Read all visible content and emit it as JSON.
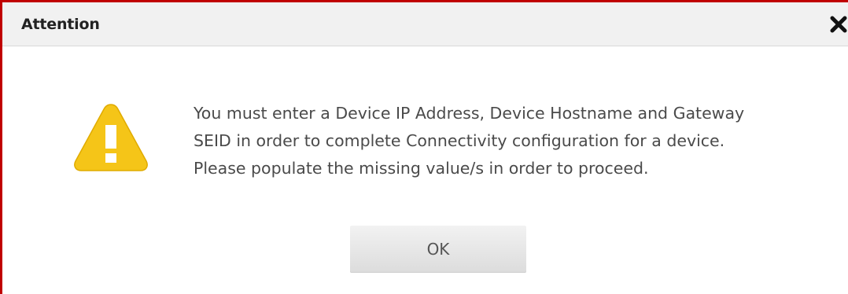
{
  "dialog": {
    "title": "Attention",
    "close_icon": "close-icon",
    "warning_icon": "warning-icon",
    "message_lines": [
      "You must enter a Device IP Address, Device Hostname and Gateway",
      "SEID in order to complete Connectivity configuration for a device.",
      "Please populate the missing value/s in order to proceed."
    ],
    "ok_label": "OK"
  },
  "colors": {
    "border": "#c00000",
    "titlebar_bg": "#f1f1f1",
    "warning_fill": "#f5c518",
    "text": "#4a4a4a"
  }
}
